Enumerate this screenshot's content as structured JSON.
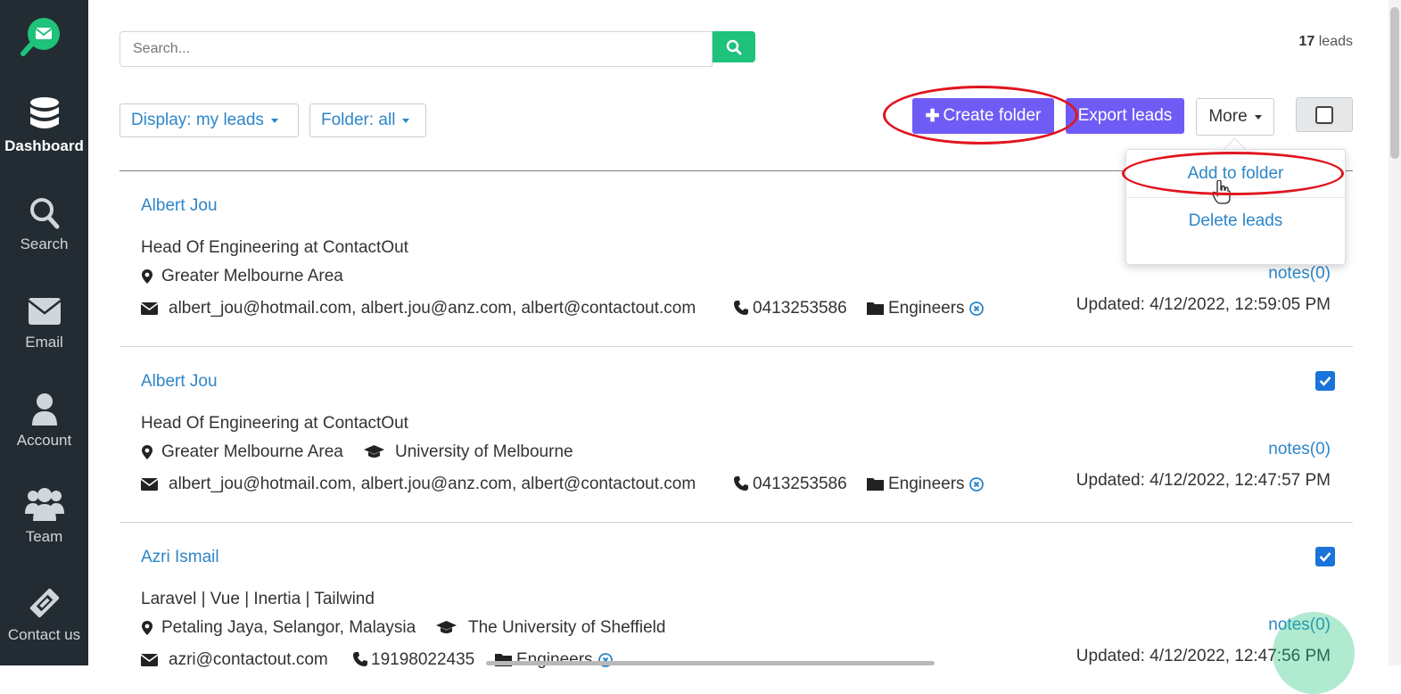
{
  "sidebar": {
    "items": [
      {
        "label": "Dashboard",
        "icon": "database-icon"
      },
      {
        "label": "Search",
        "icon": "search-icon"
      },
      {
        "label": "Email",
        "icon": "envelope-icon"
      },
      {
        "label": "Account",
        "icon": "user-icon"
      },
      {
        "label": "Team",
        "icon": "users-icon"
      },
      {
        "label": "Contact us",
        "icon": "ticket-icon"
      }
    ]
  },
  "search": {
    "placeholder": "Search..."
  },
  "lead_count": {
    "number": "17",
    "suffix": " leads"
  },
  "filters": {
    "display": "Display: my leads",
    "folder": "Folder: all"
  },
  "actions": {
    "create_folder": "Create folder",
    "export_leads": "Export leads",
    "more": "More"
  },
  "more_menu": {
    "add_to_folder": "Add to folder",
    "delete_leads": "Delete leads"
  },
  "leads": [
    {
      "name": "Albert Jou",
      "title": "Head Of Engineering at ContactOut",
      "location": "Greater Melbourne Area",
      "education": "",
      "emails": "albert_jou@hotmail.com, albert.jou@anz.com, albert@contactout.com",
      "phone": "0413253586",
      "folder": "Engineers",
      "notes": "notes(0)",
      "updated": "Updated: 4/12/2022, 12:59:05 PM",
      "checked": false
    },
    {
      "name": "Albert Jou",
      "title": "Head Of Engineering at ContactOut",
      "location": "Greater Melbourne Area",
      "education": "University of Melbourne",
      "emails": "albert_jou@hotmail.com, albert.jou@anz.com, albert@contactout.com",
      "phone": "0413253586",
      "folder": "Engineers",
      "notes": "notes(0)",
      "updated": "Updated: 4/12/2022, 12:47:57 PM",
      "checked": true
    },
    {
      "name": "Azri Ismail",
      "title": "Laravel | Vue | Inertia | Tailwind",
      "location": "Petaling Jaya, Selangor, Malaysia",
      "education": "The University of Sheffield",
      "emails": "azri@contactout.com",
      "phone": "19198022435",
      "folder": "Engineers",
      "notes": "notes(0)",
      "updated": "Updated: 4/12/2022, 12:47:56 PM",
      "checked": true
    }
  ],
  "colors": {
    "sidebar": "#232c33",
    "accent_green": "#1ec27a",
    "purple": "#6f5cf5",
    "link": "#2d86c8",
    "annotation": "#e0141e"
  }
}
